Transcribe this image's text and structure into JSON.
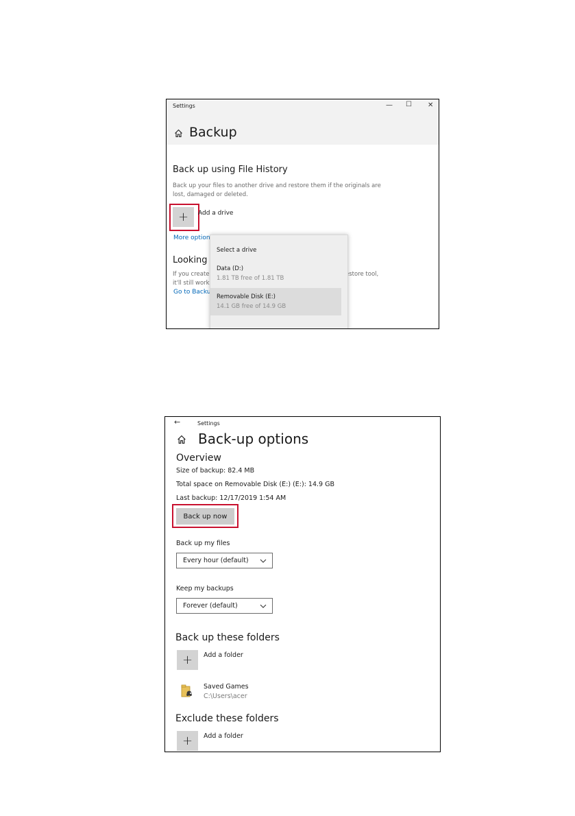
{
  "backup_window": {
    "title": "Settings",
    "page_title": "Backup",
    "section_title": "Back up using File History",
    "description_line1": "Back up your files to another drive and restore them if the originals are",
    "description_line2": "lost, damaged or deleted.",
    "add_drive_label": "Add a drive",
    "more_options_link": "More option",
    "looking_heading": "Looking f",
    "looking_text_line1": "If you create",
    "looking_text_line2": "it'll still work",
    "looking_text_right": "estore tool,",
    "go_to_backup_link": "Go to Backu",
    "controls": {
      "minimize": "—",
      "maximize": "☐",
      "close": "✕"
    },
    "drive_flyout": {
      "heading": "Select a drive",
      "drives": [
        {
          "name": "Data (D:)",
          "free": "1.81 TB free of 1.81 TB"
        },
        {
          "name": "Removable Disk (E:)",
          "free": "14.1 GB free of 14.9 GB"
        }
      ]
    }
  },
  "options_window": {
    "back_arrow": "←",
    "title": "Settings",
    "page_title": "Back-up options",
    "overview_heading": "Overview",
    "size_of_backup": "Size of backup: 82.4 MB",
    "total_space": "Total space on Removable Disk (E:) (E:): 14.9 GB",
    "last_backup": "Last backup: 12/17/2019 1:54 AM",
    "back_up_now_button": "Back up now",
    "back_up_my_files_label": "Back up my files",
    "back_up_my_files_value": "Every hour (default)",
    "keep_backups_label": "Keep my backups",
    "keep_backups_value": "Forever (default)",
    "backup_folders_heading": "Back up these folders",
    "add_folder_label": "Add a folder",
    "folders": [
      {
        "name": "Saved Games",
        "path": "C:\\Users\\acer"
      }
    ],
    "exclude_heading": "Exclude these folders",
    "exclude_add_folder_label": "Add a folder"
  },
  "colors": {
    "highlight_box": "#c8102e",
    "link": "#0067b8",
    "tile_grey": "#d3d3d3"
  }
}
